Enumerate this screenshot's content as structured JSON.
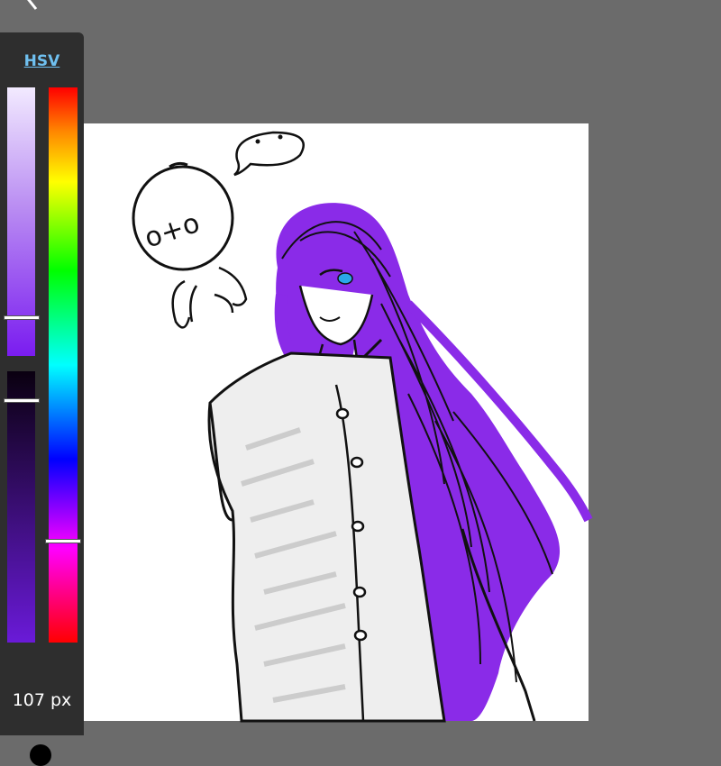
{
  "toolbar": {
    "back_icon": "chevron-left-icon"
  },
  "color_panel": {
    "mode_label": "HSV",
    "brush_size_label": "107 px",
    "selected_color": "#7a1cf0",
    "hue_position": 0.82,
    "saturation_position": 0.86,
    "value_position": 0.1
  },
  "canvas": {
    "background": "#ffffff",
    "hair_color": "#8a2be8",
    "eye_color": "#2aa8e8",
    "sketch_text": "o+o"
  }
}
